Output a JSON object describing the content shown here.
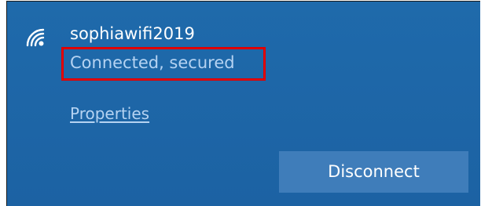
{
  "network": {
    "icon": "wifi-signal-icon",
    "name": "sophiawifi2019",
    "status": "Connected, secured",
    "properties_label": "Properties",
    "disconnect_label": "Disconnect"
  },
  "colors": {
    "panel_background": "#1f6aab",
    "text_primary": "#ffffff",
    "text_secondary": "#b5d3f2",
    "button_background": "#3f7dba",
    "highlight_border": "#e00000"
  }
}
